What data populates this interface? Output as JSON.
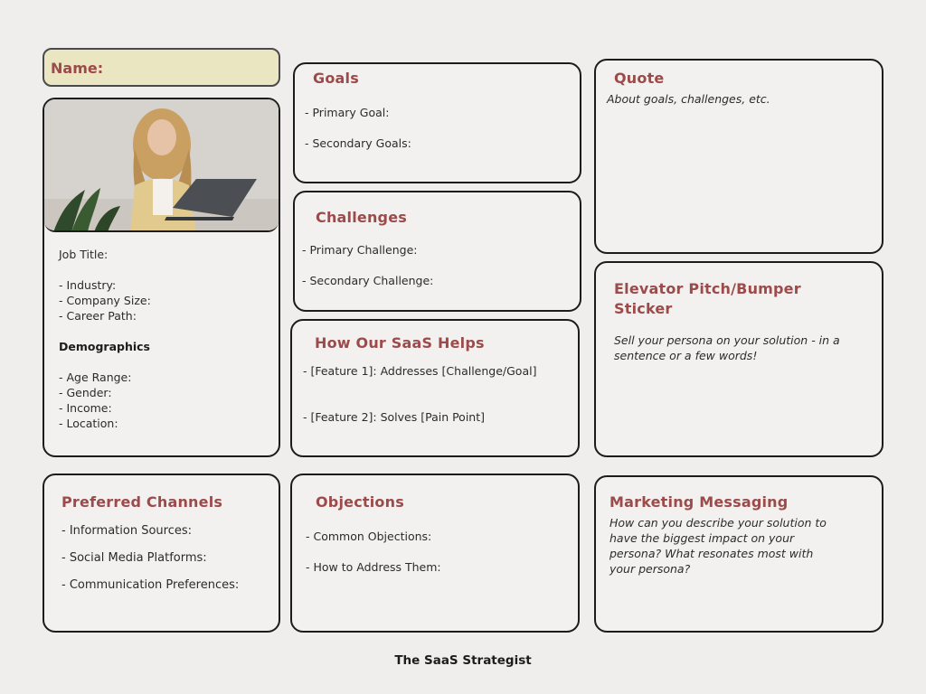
{
  "name_label": "Name:",
  "profile": {
    "job_title": "Job Title:",
    "industry": "- Industry:",
    "company_size": "- Company Size:",
    "career_path": "- Career Path:",
    "demographics_heading": "Demographics",
    "age_range": "- Age Range:",
    "gender": "- Gender:",
    "income": "- Income:",
    "location": "- Location:"
  },
  "goals": {
    "title": "Goals",
    "primary": "- Primary Goal:",
    "secondary": "- Secondary Goals:"
  },
  "challenges": {
    "title": "Challenges",
    "primary": "- Primary Challenge:",
    "secondary": "- Secondary Challenge:"
  },
  "helps": {
    "title": "How Our SaaS Helps",
    "feature1": "-  [Feature 1]: Addresses [Challenge/Goal]",
    "feature2": "- [Feature 2]: Solves [Pain Point]"
  },
  "quote": {
    "title": "Quote",
    "body": "About goals, challenges, etc."
  },
  "pitch": {
    "title_line1": "Elevator Pitch/Bumper",
    "title_line2": "Sticker",
    "body_line1": "Sell your persona on your solution - in a",
    "body_line2": "sentence or a few words!"
  },
  "channels": {
    "title": "Preferred Channels",
    "info": "- Information Sources:",
    "social": "- Social Media Platforms:",
    "comm": "- Communication Preferences:"
  },
  "objections": {
    "title": "Objections",
    "common": "- Common Objections:",
    "address": "- How to Address Them:"
  },
  "messaging": {
    "title": "Marketing Messaging",
    "line1": "How can you describe your solution to",
    "line2": "have the biggest impact on your",
    "line3": "persona? What resonates most with",
    "line4": "your persona?"
  },
  "footer": "The SaaS Strategist",
  "colors": {
    "accent": "#9c4a4a",
    "name_fill": "#ebe6c2",
    "background": "#efeeec"
  }
}
